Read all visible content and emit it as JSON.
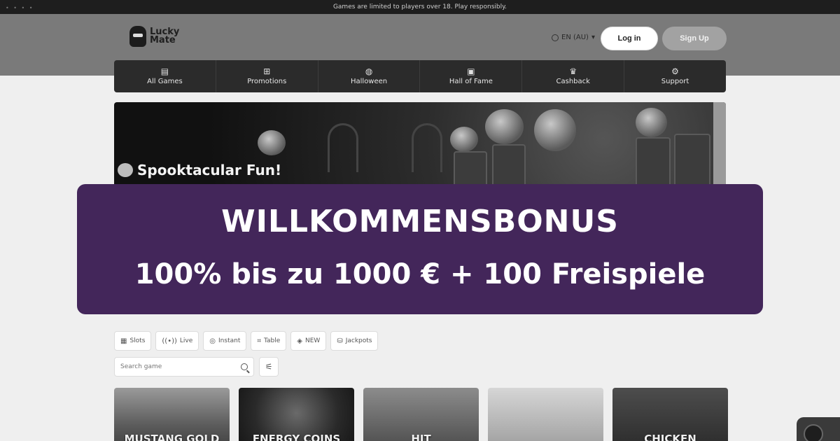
{
  "topbar": {
    "notice": "Games are limited to players over 18. Play responsibly."
  },
  "header": {
    "logo_line1": "Lucky",
    "logo_line2": "Mate",
    "language": "EN (AU)",
    "login_label": "Log in",
    "signup_label": "Sign Up"
  },
  "nav": {
    "items": [
      {
        "label": "All Games",
        "icon": "game-library-icon"
      },
      {
        "label": "Promotions",
        "icon": "gift-icon"
      },
      {
        "label": "Halloween",
        "icon": "pumpkin-icon"
      },
      {
        "label": "Hall of Fame",
        "icon": "hall-of-fame-icon"
      },
      {
        "label": "Cashback",
        "icon": "crown-icon"
      },
      {
        "label": "Support",
        "icon": "support-icon"
      }
    ]
  },
  "banner": {
    "title": "Spooktacular Fun!"
  },
  "promo": {
    "title": "WILLKOMMENSBONUS",
    "subtitle": "100% bis zu 1000 € + 100 Freispiele",
    "background": "#43265a"
  },
  "filters": {
    "chips": [
      {
        "label": "Slots",
        "icon": "slots-icon"
      },
      {
        "label": "Live",
        "icon": "live-icon"
      },
      {
        "label": "Instant",
        "icon": "instant-icon"
      },
      {
        "label": "Table",
        "icon": "table-icon"
      },
      {
        "label": "NEW",
        "icon": "new-icon"
      },
      {
        "label": "Jackpots",
        "icon": "jackpot-icon"
      }
    ]
  },
  "search": {
    "placeholder": "Search game"
  },
  "games": [
    {
      "title": "MUSTANG GOLD"
    },
    {
      "title": "ENERGY COINS"
    },
    {
      "title": "HIT"
    },
    {
      "title": ""
    },
    {
      "title": "CHICKEN"
    }
  ]
}
